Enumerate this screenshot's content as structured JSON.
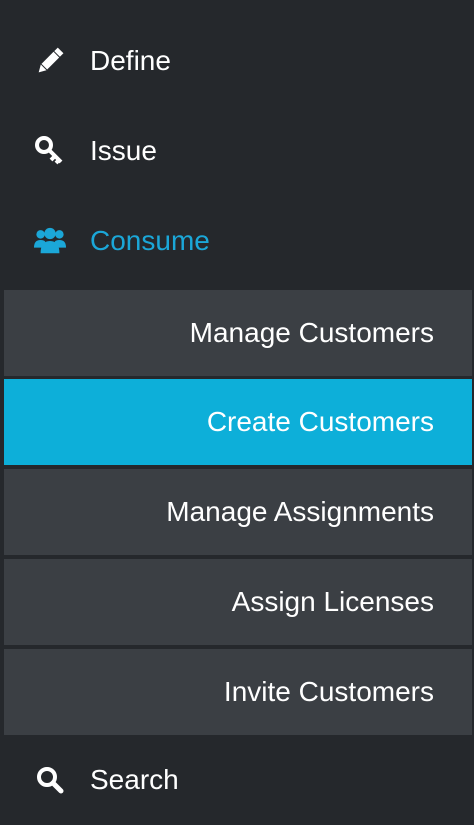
{
  "nav": {
    "define": {
      "label": "Define",
      "icon": "pencil-icon"
    },
    "issue": {
      "label": "Issue",
      "icon": "key-icon"
    },
    "consume": {
      "label": "Consume",
      "icon": "users-icon"
    },
    "search": {
      "label": "Search",
      "icon": "search-icon"
    }
  },
  "submenu": {
    "items": [
      {
        "label": "Manage Customers",
        "selected": false
      },
      {
        "label": "Create Customers",
        "selected": true
      },
      {
        "label": "Manage Assignments",
        "selected": false
      },
      {
        "label": "Assign Licenses",
        "selected": false
      },
      {
        "label": "Invite Customers",
        "selected": false
      }
    ]
  },
  "colors": {
    "background": "#25282c",
    "submenu_item": "#3b3f44",
    "selected": "#0dafd9",
    "active_text": "#1ba7d8",
    "text": "#ffffff"
  }
}
